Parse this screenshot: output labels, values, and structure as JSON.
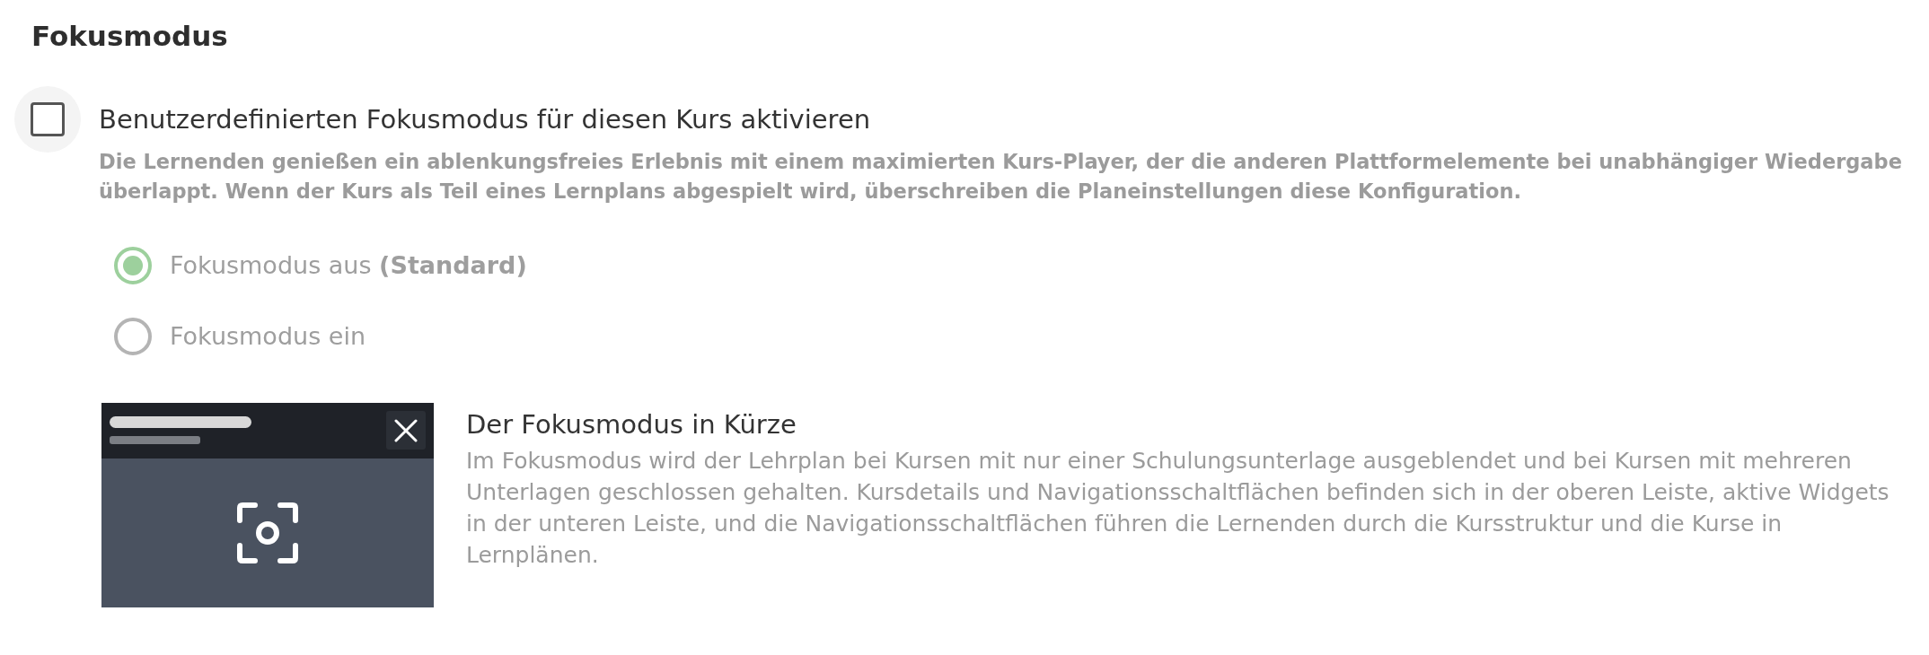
{
  "heading": "Fokusmodus",
  "custom_focus": {
    "label": "Benutzerdefinierten Fokusmodus für diesen Kurs aktivieren",
    "checked": false,
    "description": "Die Lernenden genießen ein ablenkungsfreies Erlebnis mit einem maximierten Kurs-Player, der die anderen Plattformelemente bei unabhängiger Wiedergabe überlappt. Wenn der Kurs als Teil eines Lernplans abgespielt wird, überschreiben die Planeinstellungen diese Konfiguration."
  },
  "focus_options": [
    {
      "label": "Fokusmodus aus **(Standard)**",
      "selected": true,
      "disabled": true
    },
    {
      "label": "Fokusmodus ein",
      "selected": false,
      "disabled": true
    }
  ],
  "info": {
    "title": "Der Fokusmodus in Kürze",
    "text": "Im Fokusmodus wird der Lehrplan bei Kursen mit nur einer Schulungsunterlage ausgeblendet und bei Kursen mit mehreren Unterlagen geschlossen gehalten. Kursdetails und Navigationsschaltflächen befinden sich in der oberen Leiste, aktive Widgets in der unteren Leiste, und die Navigationsschaltflächen führen die Lernenden durch die Kursstruktur und die Kurse in Lernplänen."
  }
}
